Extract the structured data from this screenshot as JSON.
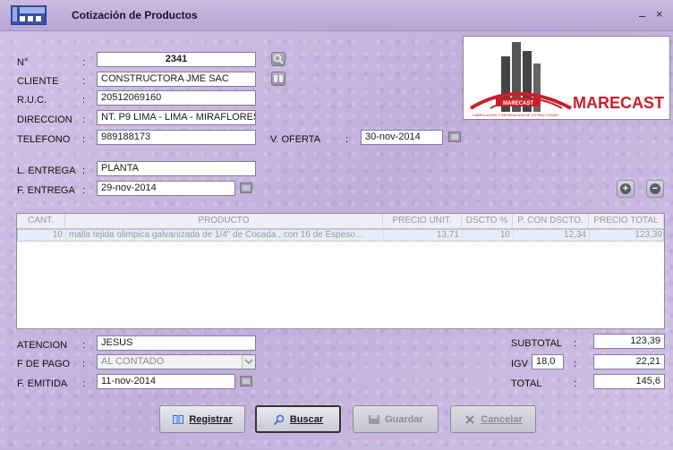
{
  "window": {
    "title": "Cotización de Productos",
    "minimize": "–",
    "close": "×"
  },
  "form": {
    "numero": {
      "label": "N°",
      "value": "2341"
    },
    "cliente": {
      "label": "CLIENTE",
      "value": "CONSTRUCTORA JME SAC"
    },
    "ruc": {
      "label": "R.U.C.",
      "value": "20512069160"
    },
    "direccion": {
      "label": "DIRECCION",
      "value": "NT. P9 LIMA - LIMA - MIRAFLORES"
    },
    "telefono": {
      "label": "TELEFONO",
      "value": "989188173"
    },
    "oferta": {
      "label": "V. OFERTA",
      "value": "30-nov-2014"
    },
    "lugar_entrega": {
      "label": "L. ENTREGA",
      "value": "PLANTA"
    },
    "fecha_entrega": {
      "label": "F. ENTREGA",
      "value": "29-nov-2014"
    },
    "colon": ":"
  },
  "logo": {
    "text": "MARECAST",
    "inner_text": "MARECAST",
    "tagline": "FABRICACION Y REPARACION DE ESTRUCTURAS"
  },
  "table": {
    "columns": [
      "CANT.",
      "PRODUCTO",
      "PRECIO UNIT.",
      "DSCTO %",
      "P. CON DSCTO.",
      "PRECIO TOTAL"
    ],
    "rows": [
      {
        "cant": "10",
        "producto": "malla tejida olimpica galvanizada de 1/4\" de Cocada , con 16 de Espeso...",
        "precio_unit": "13,71",
        "dscto": "10",
        "p_con_dscto": "12,34",
        "precio_total": "123,39"
      }
    ]
  },
  "footer": {
    "atencion": {
      "label": "ATENCION",
      "value": "JESUS"
    },
    "pago": {
      "label": "F DE PAGO",
      "value": "AL CONTADO"
    },
    "emitida": {
      "label": "F. EMITIDA",
      "value": "11-nov-2014"
    },
    "subtotal": {
      "label": "SUBTOTAL",
      "value": "123,39"
    },
    "igv": {
      "label": "IGV",
      "rate": "18,0",
      "value": "22,21"
    },
    "total": {
      "label": "TOTAL",
      "value": "145,6"
    }
  },
  "buttons": {
    "registrar": "Registrar",
    "buscar": "Buscar",
    "guardar": "Guardar",
    "cancelar": "Cancelar"
  }
}
